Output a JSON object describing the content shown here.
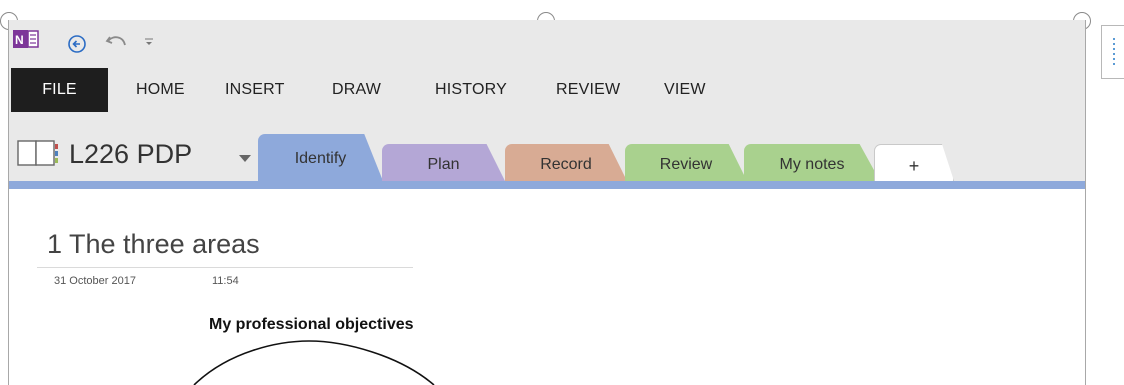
{
  "quick_access": {
    "app_icon": "onenote-icon",
    "back_icon": "back-arrow-icon",
    "undo_icon": "undo-icon",
    "customize_icon": "dropdown-icon"
  },
  "ribbon": {
    "tabs": [
      "FILE",
      "HOME",
      "INSERT",
      "DRAW",
      "HISTORY",
      "REVIEW",
      "VIEW"
    ]
  },
  "notebook": {
    "title": "L226 PDP",
    "icon": "notebook-icon",
    "dropdown_icon": "caret-down-icon"
  },
  "sections": [
    {
      "label": "Identify",
      "color": "#8ea9db",
      "active": true
    },
    {
      "label": "Plan",
      "color": "#b4a7d6"
    },
    {
      "label": "Record",
      "color": "#d8ab94"
    },
    {
      "label": "Review",
      "color": "#a9d18e"
    },
    {
      "label": "My notes",
      "color": "#a9d18e"
    },
    {
      "label": "+",
      "color": "#ffffff"
    }
  ],
  "page": {
    "title": "1 The three areas",
    "date": "31 October 2017",
    "time": "11:54",
    "heading": "My professional objectives"
  }
}
